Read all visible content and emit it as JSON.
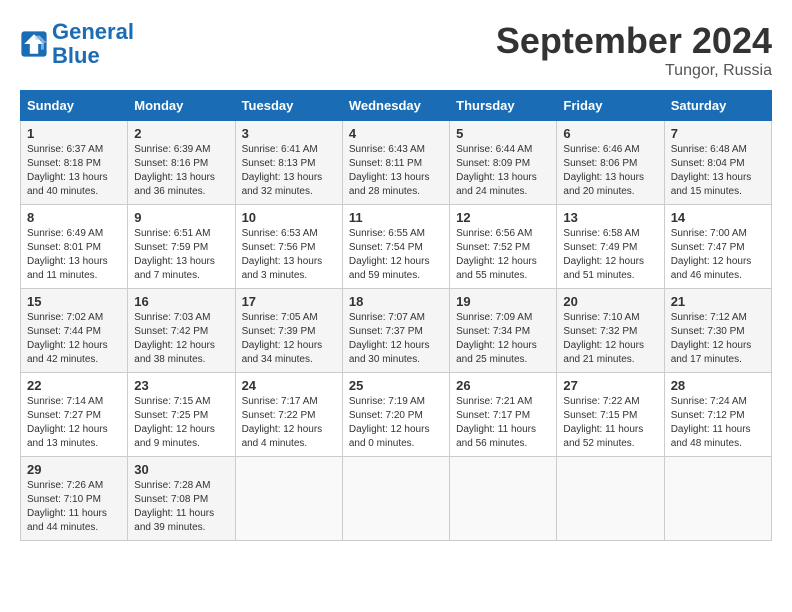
{
  "logo": {
    "line1": "General",
    "line2": "Blue"
  },
  "title": "September 2024",
  "location": "Tungor, Russia",
  "days_of_week": [
    "Sunday",
    "Monday",
    "Tuesday",
    "Wednesday",
    "Thursday",
    "Friday",
    "Saturday"
  ],
  "weeks": [
    [
      {
        "num": "1",
        "info": "Sunrise: 6:37 AM\nSunset: 8:18 PM\nDaylight: 13 hours\nand 40 minutes."
      },
      {
        "num": "2",
        "info": "Sunrise: 6:39 AM\nSunset: 8:16 PM\nDaylight: 13 hours\nand 36 minutes."
      },
      {
        "num": "3",
        "info": "Sunrise: 6:41 AM\nSunset: 8:13 PM\nDaylight: 13 hours\nand 32 minutes."
      },
      {
        "num": "4",
        "info": "Sunrise: 6:43 AM\nSunset: 8:11 PM\nDaylight: 13 hours\nand 28 minutes."
      },
      {
        "num": "5",
        "info": "Sunrise: 6:44 AM\nSunset: 8:09 PM\nDaylight: 13 hours\nand 24 minutes."
      },
      {
        "num": "6",
        "info": "Sunrise: 6:46 AM\nSunset: 8:06 PM\nDaylight: 13 hours\nand 20 minutes."
      },
      {
        "num": "7",
        "info": "Sunrise: 6:48 AM\nSunset: 8:04 PM\nDaylight: 13 hours\nand 15 minutes."
      }
    ],
    [
      {
        "num": "8",
        "info": "Sunrise: 6:49 AM\nSunset: 8:01 PM\nDaylight: 13 hours\nand 11 minutes."
      },
      {
        "num": "9",
        "info": "Sunrise: 6:51 AM\nSunset: 7:59 PM\nDaylight: 13 hours\nand 7 minutes."
      },
      {
        "num": "10",
        "info": "Sunrise: 6:53 AM\nSunset: 7:56 PM\nDaylight: 13 hours\nand 3 minutes."
      },
      {
        "num": "11",
        "info": "Sunrise: 6:55 AM\nSunset: 7:54 PM\nDaylight: 12 hours\nand 59 minutes."
      },
      {
        "num": "12",
        "info": "Sunrise: 6:56 AM\nSunset: 7:52 PM\nDaylight: 12 hours\nand 55 minutes."
      },
      {
        "num": "13",
        "info": "Sunrise: 6:58 AM\nSunset: 7:49 PM\nDaylight: 12 hours\nand 51 minutes."
      },
      {
        "num": "14",
        "info": "Sunrise: 7:00 AM\nSunset: 7:47 PM\nDaylight: 12 hours\nand 46 minutes."
      }
    ],
    [
      {
        "num": "15",
        "info": "Sunrise: 7:02 AM\nSunset: 7:44 PM\nDaylight: 12 hours\nand 42 minutes."
      },
      {
        "num": "16",
        "info": "Sunrise: 7:03 AM\nSunset: 7:42 PM\nDaylight: 12 hours\nand 38 minutes."
      },
      {
        "num": "17",
        "info": "Sunrise: 7:05 AM\nSunset: 7:39 PM\nDaylight: 12 hours\nand 34 minutes."
      },
      {
        "num": "18",
        "info": "Sunrise: 7:07 AM\nSunset: 7:37 PM\nDaylight: 12 hours\nand 30 minutes."
      },
      {
        "num": "19",
        "info": "Sunrise: 7:09 AM\nSunset: 7:34 PM\nDaylight: 12 hours\nand 25 minutes."
      },
      {
        "num": "20",
        "info": "Sunrise: 7:10 AM\nSunset: 7:32 PM\nDaylight: 12 hours\nand 21 minutes."
      },
      {
        "num": "21",
        "info": "Sunrise: 7:12 AM\nSunset: 7:30 PM\nDaylight: 12 hours\nand 17 minutes."
      }
    ],
    [
      {
        "num": "22",
        "info": "Sunrise: 7:14 AM\nSunset: 7:27 PM\nDaylight: 12 hours\nand 13 minutes."
      },
      {
        "num": "23",
        "info": "Sunrise: 7:15 AM\nSunset: 7:25 PM\nDaylight: 12 hours\nand 9 minutes."
      },
      {
        "num": "24",
        "info": "Sunrise: 7:17 AM\nSunset: 7:22 PM\nDaylight: 12 hours\nand 4 minutes."
      },
      {
        "num": "25",
        "info": "Sunrise: 7:19 AM\nSunset: 7:20 PM\nDaylight: 12 hours\nand 0 minutes."
      },
      {
        "num": "26",
        "info": "Sunrise: 7:21 AM\nSunset: 7:17 PM\nDaylight: 11 hours\nand 56 minutes."
      },
      {
        "num": "27",
        "info": "Sunrise: 7:22 AM\nSunset: 7:15 PM\nDaylight: 11 hours\nand 52 minutes."
      },
      {
        "num": "28",
        "info": "Sunrise: 7:24 AM\nSunset: 7:12 PM\nDaylight: 11 hours\nand 48 minutes."
      }
    ],
    [
      {
        "num": "29",
        "info": "Sunrise: 7:26 AM\nSunset: 7:10 PM\nDaylight: 11 hours\nand 44 minutes."
      },
      {
        "num": "30",
        "info": "Sunrise: 7:28 AM\nSunset: 7:08 PM\nDaylight: 11 hours\nand 39 minutes."
      },
      null,
      null,
      null,
      null,
      null
    ]
  ]
}
